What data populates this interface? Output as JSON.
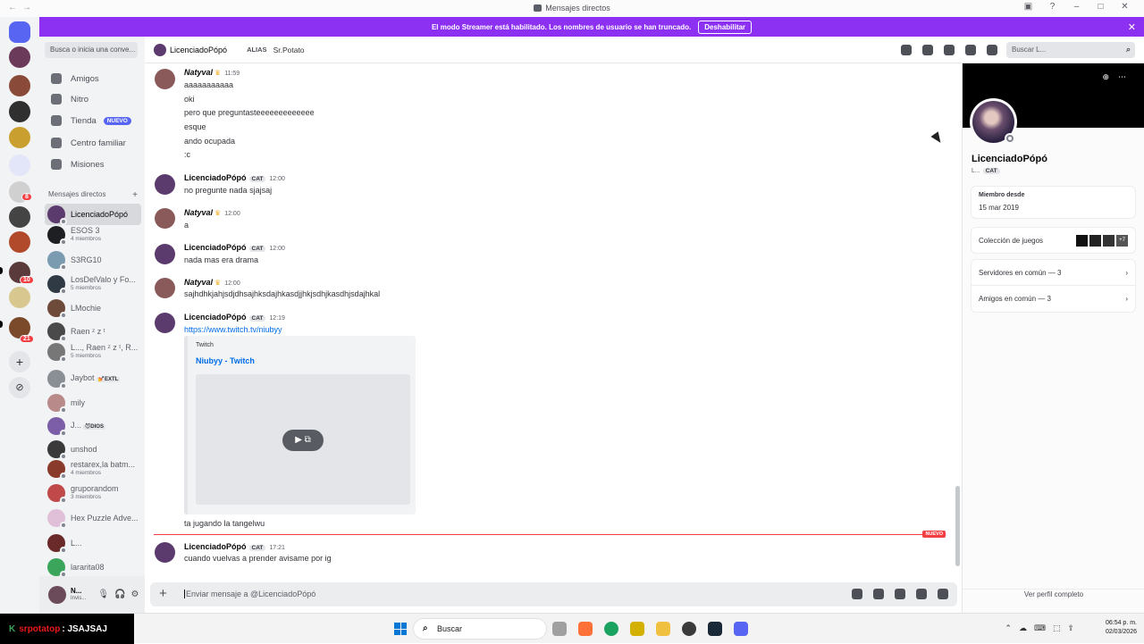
{
  "window": {
    "title": "Mensajes directos",
    "nav_back": "←",
    "nav_forward": "→"
  },
  "banner": {
    "text": "El modo Streamer está habilitado. Los nombres de usuario se han truncado.",
    "button": "Deshabilitar",
    "close": "✕"
  },
  "sidebar": {
    "search_placeholder": "Busca o inicia una conve...",
    "nav": [
      {
        "label": "Amigos"
      },
      {
        "label": "Nitro"
      },
      {
        "label": "Tienda",
        "badge": "NUEVO"
      },
      {
        "label": "Centro familiar"
      },
      {
        "label": "Misiones"
      }
    ],
    "dm_header": "Mensajes directos",
    "dm_add": "+",
    "dms": [
      {
        "name": "LicenciadoPópó",
        "sub": "",
        "color": "#5b3a6e"
      },
      {
        "name": "ESOS 3",
        "sub": "4 miembros",
        "color": "#1e1f22"
      },
      {
        "name": "S3RG10",
        "sub": "",
        "color": "#7a9bb0"
      },
      {
        "name": "LosDelValo y Fo...",
        "sub": "5 miembros",
        "color": "#2f3a45"
      },
      {
        "name": "LMochie",
        "sub": "",
        "color": "#6e4a3a"
      },
      {
        "name": "Raen ᶻ z ᵗ",
        "sub": "",
        "color": "#4a4a4a"
      },
      {
        "name": "L..., Raen ᶻ z ᵗ, R...",
        "sub": "5 miembros",
        "color": "#777"
      },
      {
        "name": "Jaybot",
        "tag": "💅EXTL",
        "sub": "",
        "color": "#8a8f96"
      },
      {
        "name": "mily",
        "sub": "",
        "color": "#b88a8a"
      },
      {
        "name": "J...",
        "tag": "😈DIOS",
        "sub": "",
        "color": "#7b5ea7"
      },
      {
        "name": "unshod",
        "sub": "",
        "color": "#3a3a3a"
      },
      {
        "name": "restarex,la batm...",
        "sub": "4 miembros",
        "color": "#8a3a2a"
      },
      {
        "name": "gruporandom",
        "sub": "3 miembros",
        "color": "#c04a4a"
      },
      {
        "name": "Hex Puzzle Adve...",
        "sub": "",
        "color": "#e0c0d8"
      },
      {
        "name": "L...",
        "sub": "",
        "color": "#6b2a2a"
      },
      {
        "name": "lararita08",
        "sub": "",
        "color": "#3ba55c"
      }
    ]
  },
  "user_panel": {
    "name": "N...",
    "status": "Invis..."
  },
  "chat_header": {
    "name": "LicenciadoPópó",
    "alias_label": "ALIAS",
    "alias_value": "Sr.Potato",
    "search_placeholder": "Buscar L..."
  },
  "messages": {
    "m1": {
      "author": "Natyval",
      "time": "11:59",
      "lines": [
        "aaaaaaaaaaa",
        "oki",
        "pero que preguntasteeeeeeeeeeeee",
        "esque",
        "ando ocupada",
        ":c"
      ]
    },
    "m2": {
      "author": "LicenciadoPópó",
      "badge": "CAT",
      "time": "12:00",
      "lines": [
        "no pregunte nada sjajsaj"
      ]
    },
    "m3": {
      "author": "Natyval",
      "time": "12:00",
      "lines": [
        "a"
      ]
    },
    "m4": {
      "author": "LicenciadoPópó",
      "badge": "CAT",
      "time": "12:00",
      "lines": [
        "nada mas era drama"
      ]
    },
    "m5": {
      "author": "Natyval",
      "time": "12:00",
      "lines": [
        "sajhdhkjahjsdjdhsajhksdajhkasdjjhkjsdhjkasdhjsdajhkal"
      ]
    },
    "m6": {
      "author": "LicenciadoPópó",
      "badge": "CAT",
      "time": "12:19",
      "link": "https://www.twitch.tv/niubyy",
      "embed_provider": "Twitch",
      "embed_title": "Niubyy - Twitch",
      "after": "ta jugando la tangelwu"
    },
    "new_label": "NUEVO",
    "m7": {
      "author": "LicenciadoPópó",
      "badge": "CAT",
      "time": "17:21",
      "lines": [
        "cuando vuelvas a prender avisame por ig"
      ]
    }
  },
  "composer": {
    "placeholder": "Enviar mensaje a @LicenciadoPópó"
  },
  "profile": {
    "name": "LicenciadoPópó",
    "sub": "L...",
    "badge": "CAT",
    "member_since_label": "Miembro desde",
    "member_since": "15 mar 2019",
    "games_label": "Colección de juegos",
    "games_more": "+7",
    "servers": "Servidores en común — 3",
    "friends": "Amigos en común — 3",
    "footer": "Ver perfil completo"
  },
  "taskbar": {
    "stream_user": "srpotatop",
    "stream_text": ": JSAJSAJ",
    "search": "Buscar",
    "time": "06:54 p. m.",
    "date": "02/03/2026"
  },
  "colors": {
    "accent": "#5865f2",
    "banner": "#8c31f2",
    "new_divider": "#f23f43",
    "link": "#006ce7"
  }
}
